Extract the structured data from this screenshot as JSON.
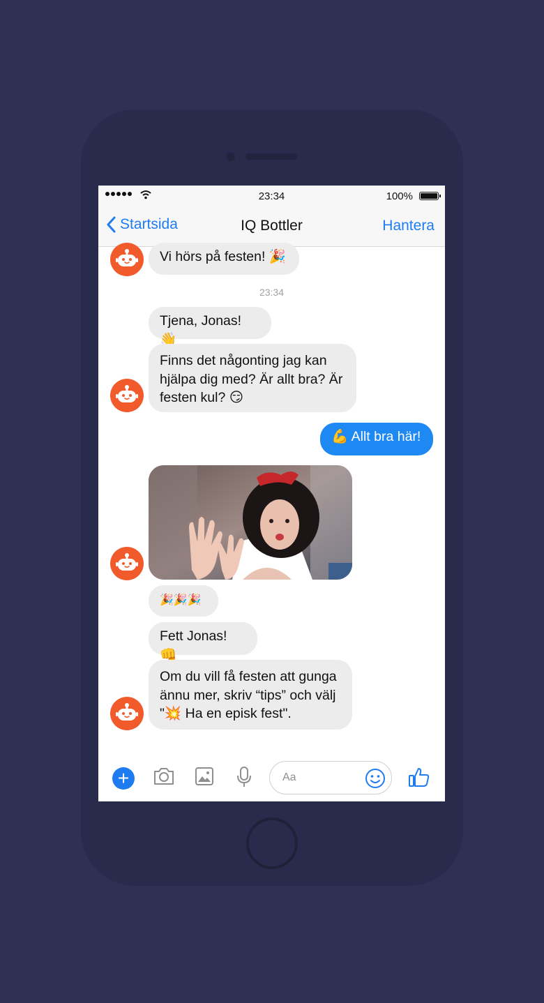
{
  "status_bar": {
    "time": "23:34",
    "battery": "100%"
  },
  "nav": {
    "back_label": "Startsida",
    "title": "IQ Bottler",
    "action_label": "Hantera"
  },
  "messages": [
    {
      "sender": "bot",
      "text": "Vi hörs på festen! 🎉"
    },
    {
      "type": "timestamp",
      "text": "23:34"
    },
    {
      "sender": "bot",
      "text": "Tjena, Jonas! 👋"
    },
    {
      "sender": "bot",
      "text": "Finns det någonting jag kan hjälpa dig med? Är allt bra? Är festen kul? 😏"
    },
    {
      "sender": "user",
      "text": "💪 Allt bra här!"
    },
    {
      "sender": "bot",
      "type": "gif",
      "description": "animated gif"
    },
    {
      "sender": "bot",
      "text": "🎉🎉🎉"
    },
    {
      "sender": "bot",
      "text": "Fett Jonas! 👊"
    },
    {
      "sender": "bot",
      "text": "Om du vill få festen att gunga ännu mer, skriv “tips” och välj \"💥 Ha en episk fest\"."
    }
  ],
  "composer": {
    "placeholder": "Aa"
  },
  "colors": {
    "background": "#2e3054",
    "accent": "#1e7cf0",
    "bot_avatar": "#f15a2b",
    "user_bubble": "#1e88f3",
    "bot_bubble": "#ececec"
  },
  "icons": [
    "back-chevron-icon",
    "bot-avatar-icon",
    "plus-icon",
    "camera-icon",
    "gallery-icon",
    "microphone-icon",
    "smiley-icon",
    "thumbs-up-icon"
  ]
}
